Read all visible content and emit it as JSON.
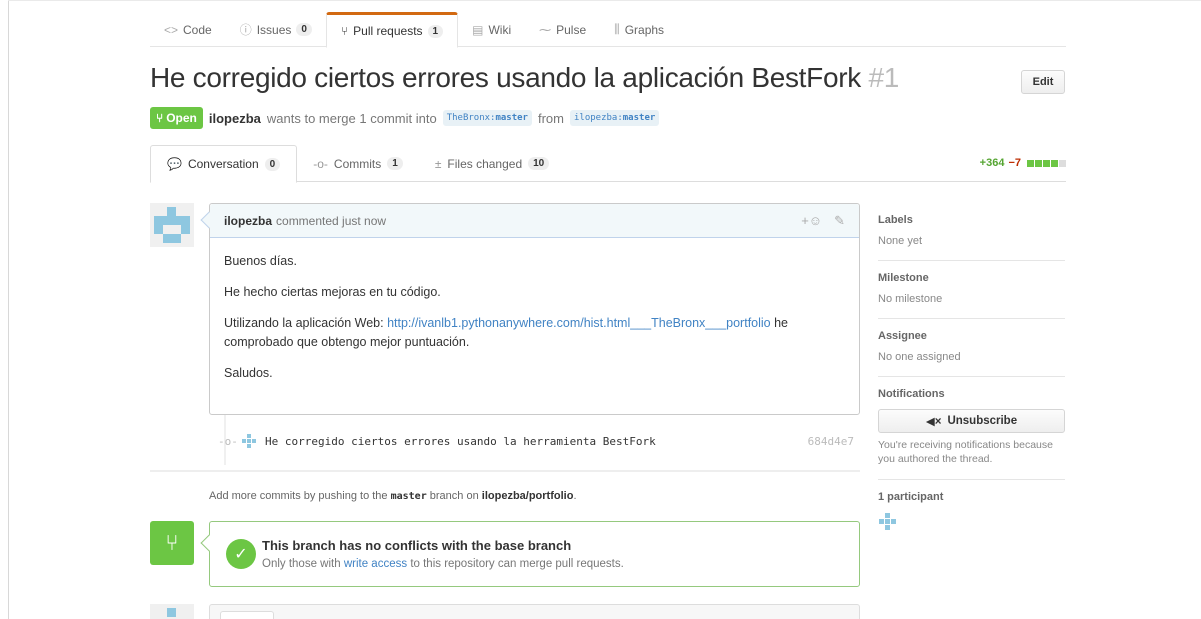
{
  "repo_nav": [
    {
      "icon": "code-icon",
      "glyph": "<>",
      "label": "Code",
      "count": ""
    },
    {
      "icon": "issue-icon",
      "glyph": "ⓘ",
      "label": "Issues",
      "count": "0"
    },
    {
      "icon": "pull-request-icon",
      "glyph": "⑂",
      "label": "Pull requests",
      "count": "1",
      "active": true
    },
    {
      "icon": "wiki-icon",
      "glyph": "▤",
      "label": "Wiki",
      "count": ""
    },
    {
      "icon": "pulse-icon",
      "glyph": "⁓",
      "label": "Pulse",
      "count": ""
    },
    {
      "icon": "graph-icon",
      "glyph": "⫼",
      "label": "Graphs",
      "count": ""
    }
  ],
  "pr": {
    "title": "He corregido ciertos errores usando la aplicación BestFork",
    "number": "#1",
    "edit_label": "Edit",
    "state": "Open",
    "author": "ilopezba",
    "merge_text": "wants to merge 1 commit into",
    "base_branch_owner": "TheBronx:",
    "base_branch_name": "master",
    "from_text": "from",
    "head_branch_owner": "ilopezba:",
    "head_branch_name": "master"
  },
  "pr_tabs": [
    {
      "icon": "conversation-icon",
      "glyph": "💬",
      "label": "Conversation",
      "count": "0"
    },
    {
      "icon": "commit-icon",
      "glyph": "-o-",
      "label": "Commits",
      "count": "1"
    },
    {
      "icon": "file-diff-icon",
      "glyph": "±",
      "label": "Files changed",
      "count": "10"
    }
  ],
  "diffstat": {
    "additions": "+364",
    "deletions": "−7"
  },
  "comment": {
    "author": "ilopezba",
    "time": "commented just now",
    "p1": "Buenos días.",
    "p2": "He hecho ciertas mejoras en tu código.",
    "p3_prefix": "Utilizando la aplicación Web: ",
    "p3_link": "http://ivanlb1.pythonanywhere.com/hist.html___TheBronx___portfolio",
    "p3_suffix": " he comprobado que obtengo mejor puntuación.",
    "p4": "Saludos."
  },
  "commit": {
    "message": "He corregido ciertos errores usando la herramienta BestFork",
    "sha": "684d4e7"
  },
  "push_hint": {
    "prefix": "Add more commits by pushing to the",
    "branch": "master",
    "middle": "branch on",
    "repo": "ilopezba/portfolio",
    "suffix": "."
  },
  "merge": {
    "title": "This branch has no conflicts with the base branch",
    "sub_prefix": "Only those with",
    "sub_link": "write access",
    "sub_suffix": "to this repository can merge pull requests."
  },
  "sidebar": {
    "labels_title": "Labels",
    "labels_value": "None yet",
    "milestone_title": "Milestone",
    "milestone_value": "No milestone",
    "assignee_title": "Assignee",
    "assignee_value": "No one assigned",
    "notifications_title": "Notifications",
    "unsubscribe_label": "Unsubscribe",
    "notifications_reason": "You're receiving notifications because you authored the thread.",
    "participants_title": "1 participant"
  },
  "colors": {
    "accent_open": "#6cc644",
    "link": "#4183c4",
    "tab_active_border": "#d26911"
  }
}
